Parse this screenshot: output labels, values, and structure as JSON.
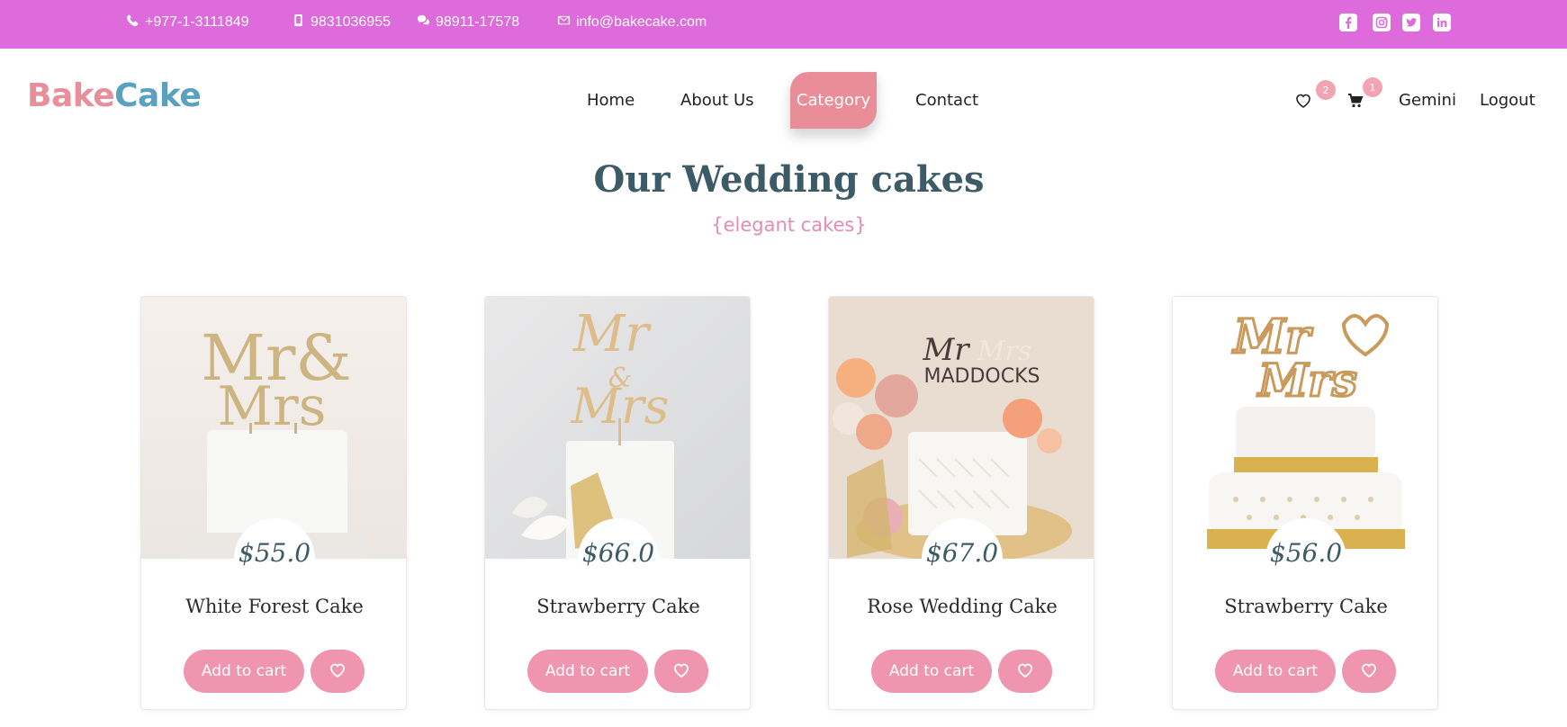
{
  "topbar": {
    "phone": "+977-1-3111849",
    "mobile": "9831036955",
    "chat": "98911-17578",
    "email": "info@bakecake.com",
    "social_icons": [
      "facebook-icon",
      "instagram-icon",
      "twitter-icon",
      "linkedin-icon"
    ],
    "background_color": "#dd6bdb"
  },
  "brand": {
    "part1": "Bake",
    "part2": "Cake",
    "color1": "#e88f9c",
    "color2": "#5aa0c0"
  },
  "nav": {
    "items": [
      "Home",
      "About Us",
      "Category",
      "Contact"
    ],
    "active": "Category",
    "wishlist_count": "2",
    "cart_count": "1",
    "user_name": "Gemini",
    "logout_label": "Logout"
  },
  "section": {
    "title": "Our Wedding cakes",
    "subtitle": "{elegant cakes}"
  },
  "products": [
    {
      "name": "White Forest Cake",
      "price": "$55.0",
      "topper": "Mr & Mrs",
      "add_label": "Add to cart"
    },
    {
      "name": "Strawberry Cake",
      "price": "$66.0",
      "topper": "Mr & Mrs",
      "add_label": "Add to cart"
    },
    {
      "name": "Rose Wedding Cake",
      "price": "$67.0",
      "topper": "Mr & Mrs MADDOCKS",
      "add_label": "Add to cart"
    },
    {
      "name": "Strawberry Cake",
      "price": "$56.0",
      "topper": "Mr & Mrs",
      "add_label": "Add to cart"
    }
  ],
  "colors": {
    "accent_pink": "#ef95b0",
    "heading": "#3d5b67",
    "subtitle": "#e58cb6"
  }
}
